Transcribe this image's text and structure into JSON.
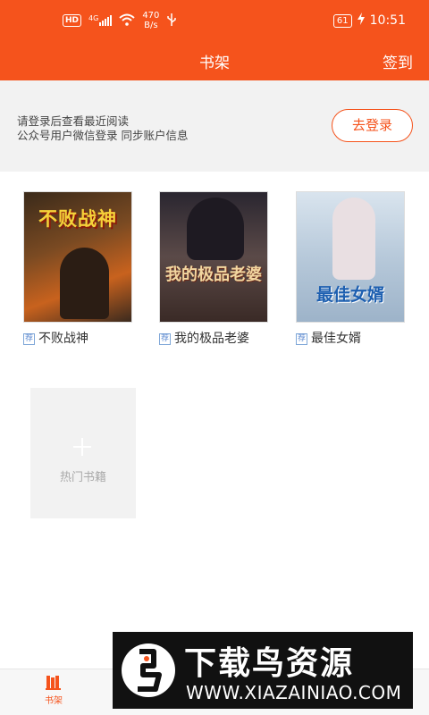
{
  "status_bar": {
    "hd_label": "HD",
    "network_label": "4G",
    "speed_value": "470",
    "speed_unit": "B/s",
    "battery": "61",
    "time": "10:51"
  },
  "header": {
    "title": "书架",
    "signin_label": "签到"
  },
  "login_panel": {
    "line1": "请登录后查看最近阅读",
    "line2": "公众号用户微信登录 同步账户信息",
    "button_label": "去登录"
  },
  "books": [
    {
      "badge": "荐",
      "title": "不败战神",
      "cover_text": "不败战神"
    },
    {
      "badge": "荐",
      "title": "我的极品老婆",
      "cover_text": "我的极品老婆"
    },
    {
      "badge": "荐",
      "title": "最佳女婿",
      "cover_text": "最佳女婿"
    }
  ],
  "add_tile": {
    "label": "热门书籍"
  },
  "tab_bar": {
    "tabs": [
      {
        "label": "书架",
        "icon": "bookshelf-icon",
        "active": true
      }
    ]
  },
  "watermark": {
    "title": "下载鸟资源",
    "url": "WWW.XIAZAINIAO.COM"
  },
  "colors": {
    "accent": "#f5531c",
    "panel_bg": "#f2f2f2",
    "badge_blue": "#5d8ad0"
  }
}
